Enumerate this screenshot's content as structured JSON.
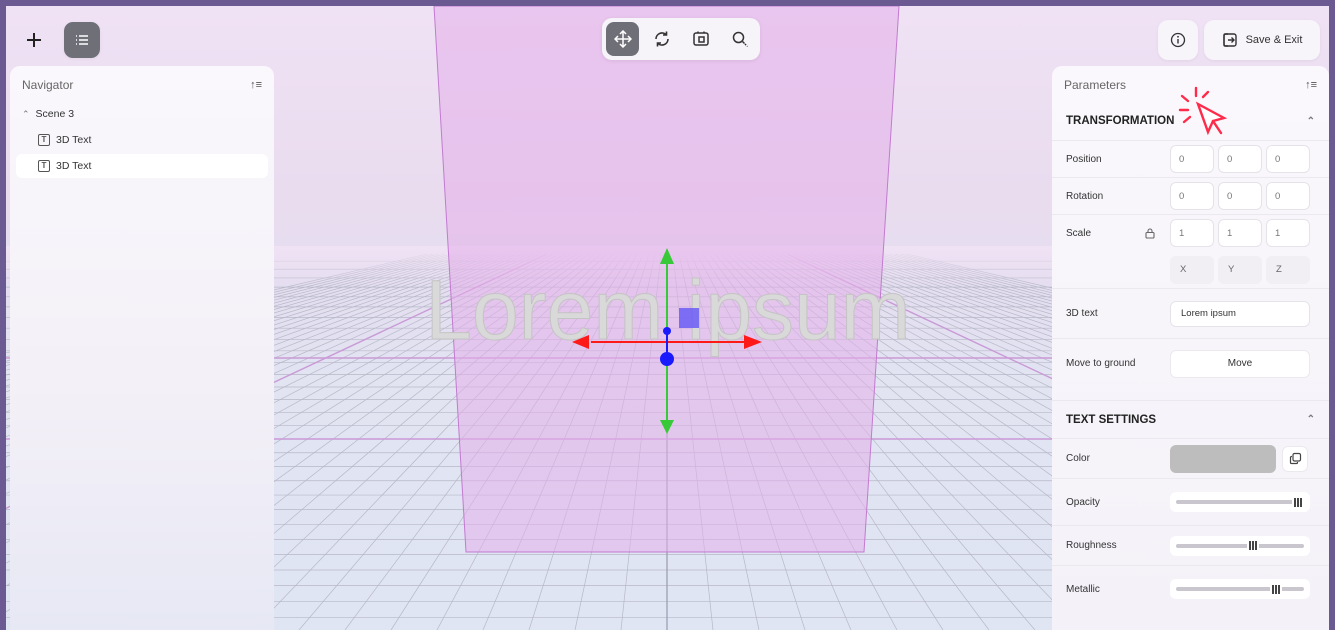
{
  "toolbar": {
    "add_icon": "plus-icon",
    "outline_icon": "list-icon",
    "tools": [
      {
        "name": "move-tool",
        "icon": "move-arrows-icon",
        "active": true
      },
      {
        "name": "rotate-tool",
        "icon": "rotate-icon",
        "active": false
      },
      {
        "name": "scale-tool",
        "icon": "scale-box-icon",
        "active": false
      },
      {
        "name": "zoom-tool",
        "icon": "magnifier-icon",
        "active": false
      }
    ],
    "info_icon": "info-icon",
    "save_label": "Save & Exit"
  },
  "navigator": {
    "title": "Navigator",
    "scene_label": "Scene 3",
    "items": [
      {
        "label": "3D Text",
        "selected": false
      },
      {
        "label": "3D Text",
        "selected": true
      }
    ]
  },
  "viewport": {
    "text": "Lorem ipsum",
    "text_color": "#d8d8d8",
    "grid_color": "#b9b9c8",
    "pane_color": "#e8b6ec",
    "gizmo": {
      "x_color": "#ff1a1a",
      "y_color": "#2ecc2e",
      "z_color": "#1a1aff",
      "center_color": "#6b5cf5"
    }
  },
  "parameters": {
    "title": "Parameters",
    "transformation": {
      "title": "TRANSFORMATION",
      "position_label": "Position",
      "position": [
        "0",
        "0",
        "0"
      ],
      "rotation_label": "Rotation",
      "rotation": [
        "0",
        "0",
        "0"
      ],
      "scale_label": "Scale",
      "scale": [
        "1",
        "1",
        "1"
      ],
      "axes": [
        "X",
        "Y",
        "Z"
      ],
      "text_label": "3D text",
      "text_value": "Lorem ipsum",
      "ground_label": "Move to ground",
      "ground_button": "Move"
    },
    "text_settings": {
      "title": "TEXT SETTINGS",
      "color_label": "Color",
      "color_value": "#bdbdbd",
      "opacity_label": "Opacity",
      "opacity": 1.0,
      "roughness_label": "Roughness",
      "roughness": 0.6,
      "metallic_label": "Metallic",
      "metallic": 0.78
    }
  },
  "accent_color": "#ff2b4a"
}
